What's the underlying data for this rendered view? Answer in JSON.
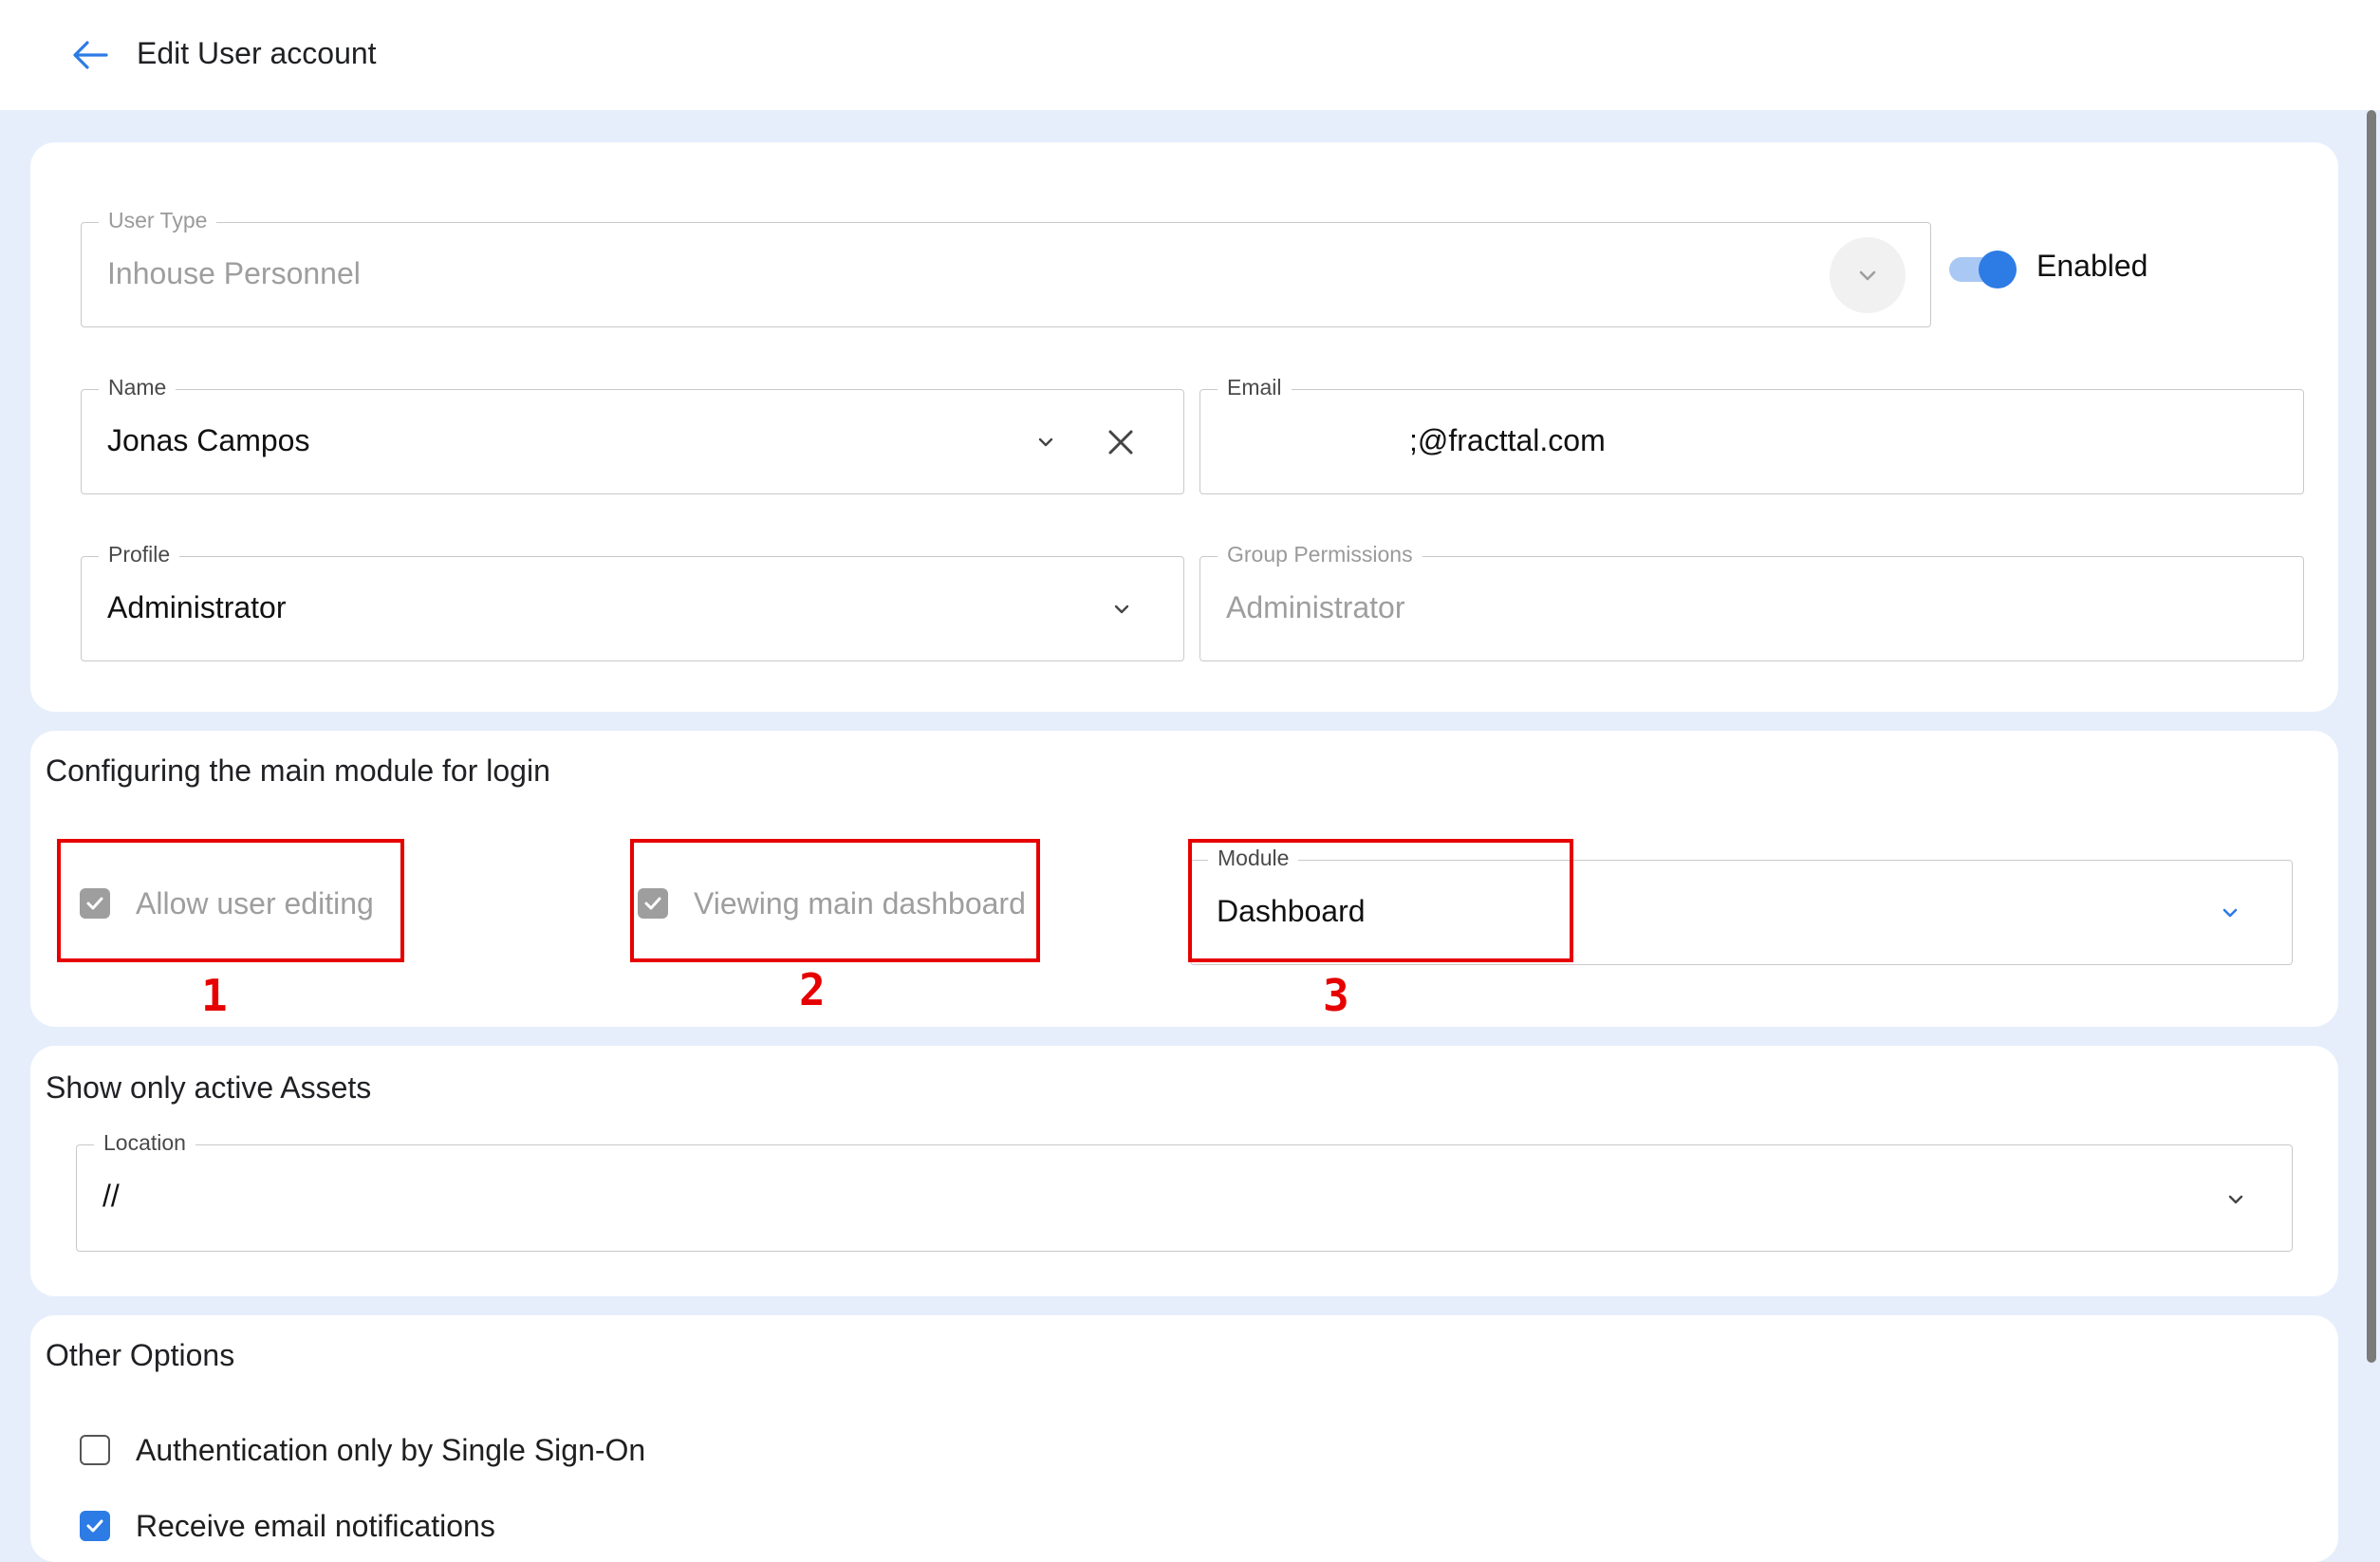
{
  "header": {
    "title": "Edit User account"
  },
  "user_type": {
    "label": "User Type",
    "value": "Inhouse Personnel"
  },
  "status_toggle": {
    "label": "Enabled",
    "on": true
  },
  "name": {
    "label": "Name",
    "value": "Jonas Campos"
  },
  "email": {
    "label": "Email",
    "value": ";@fracttal.com"
  },
  "profile": {
    "label": "Profile",
    "value": "Administrator"
  },
  "group_permissions": {
    "label": "Group Permissions",
    "value": "Administrator"
  },
  "login_module": {
    "title": "Configuring the main module for login",
    "allow_editing_label": "Allow user editing",
    "viewing_dashboard_label": "Viewing main dashboard",
    "module_label": "Module",
    "module_value": "Dashboard"
  },
  "active_assets": {
    "title": "Show only active Assets",
    "location_label": "Location",
    "location_value": "//"
  },
  "other_options": {
    "title": "Other Options",
    "sso_label": "Authentication only by Single Sign-On",
    "email_notifications_label": "Receive email notifications"
  },
  "annotations": [
    "1",
    "2",
    "3"
  ],
  "colors": {
    "accent": "#2d7be5",
    "annotation": "#e60000",
    "background": "#e6eefb"
  }
}
